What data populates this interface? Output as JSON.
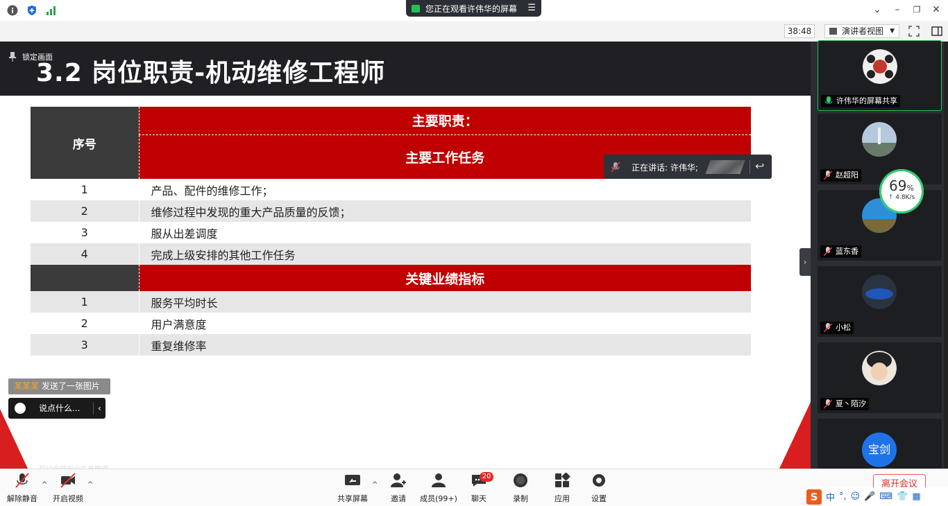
{
  "window": {
    "sharing_status": "您正在观看许伟华的屏幕",
    "min_label": "–",
    "restore_label": "❐",
    "close_label": "✕"
  },
  "toolbar": {
    "timer": "38:48",
    "view_mode": "演讲者视图"
  },
  "slide": {
    "title": "3.2 岗位职责-机动维修工程师",
    "lock_label": "锁定画面",
    "table": {
      "seq_header": "序号",
      "duties_header": "主要职责：",
      "tasks_header": "主要工作任务",
      "tasks": [
        {
          "num": "1",
          "text": "产品、配件的维修工作；"
        },
        {
          "num": "2",
          "text": "维修过程中发现的重大产品质量的反馈；"
        },
        {
          "num": "3",
          "text": "服从出差调度"
        },
        {
          "num": "4",
          "text": "完成上级安排的其他工作任务"
        }
      ],
      "kpi_header": "关键业绩指标",
      "kpis": [
        {
          "num": "1",
          "text": "服务平均时长"
        },
        {
          "num": "2",
          "text": "用户满意度"
        },
        {
          "num": "3",
          "text": "重复维修率"
        }
      ]
    },
    "footnote": "探讨全球安业生产管理"
  },
  "chat": {
    "notif_sender": "某某某",
    "notif_text": "发送了一张图片",
    "input_placeholder": "说点什么..."
  },
  "speaking": {
    "label": "正在讲话: 许伟华;"
  },
  "participants": [
    {
      "name": "许伟华的屏幕共享",
      "active": true
    },
    {
      "name": "赵超阳"
    },
    {
      "name": "蓝东香"
    },
    {
      "name": "小松"
    },
    {
      "name": "夏丶陌汐"
    },
    {
      "name": "宝剑",
      "initials": "宝剑"
    }
  ],
  "netmeter": {
    "percent": "69",
    "percent_sign": "%",
    "speed": "4.8K/s"
  },
  "bottombar": {
    "unmute": "解除静音",
    "start_video": "开启视频",
    "share_screen": "共享屏幕",
    "invite": "邀请",
    "members": "成员(99+)",
    "chat": "聊天",
    "chat_badge": "20",
    "record": "录制",
    "apps": "应用",
    "settings": "设置",
    "leave": "离开会议"
  },
  "ime": {
    "logo": "S",
    "lang": "中",
    "punct": "°,"
  },
  "colors": {
    "accent_red": "#c00000",
    "dark_header": "#3b3b3b",
    "active_green": "#28c24e"
  }
}
